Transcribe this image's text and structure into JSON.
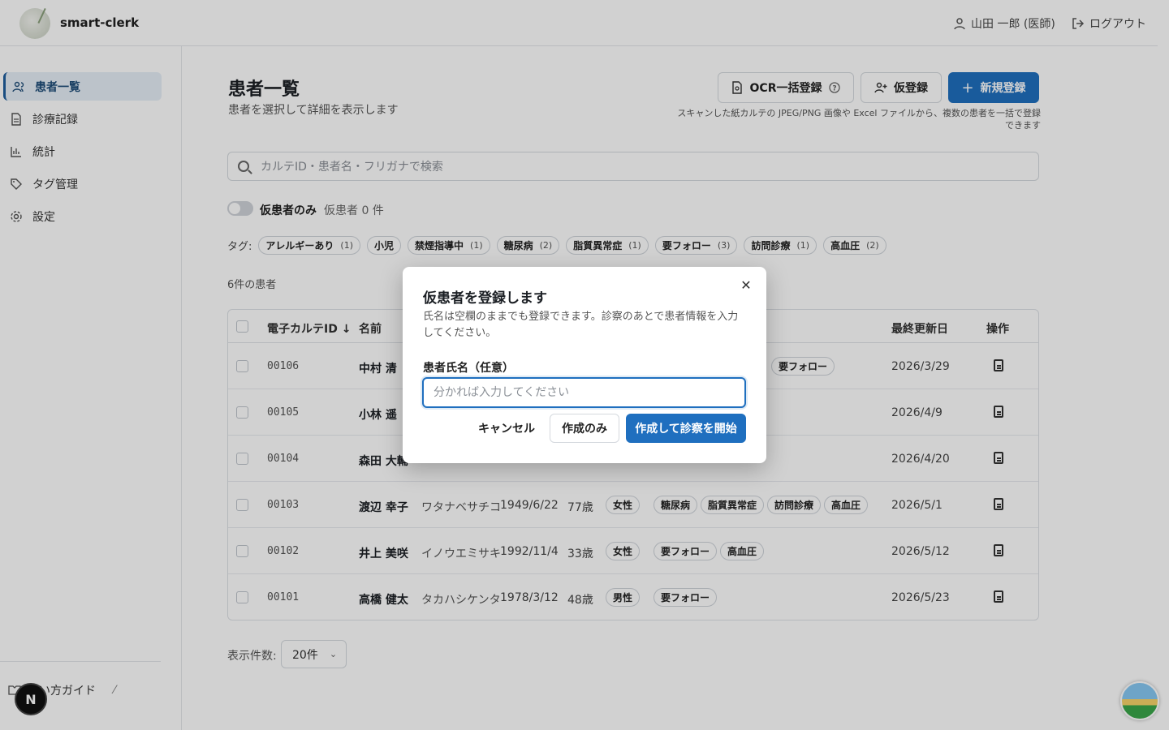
{
  "header": {
    "app_name": "smart-clerk",
    "user": "山田 一郎 (医師)",
    "logout": "ログアウト"
  },
  "sidebar": {
    "items": [
      {
        "label": "患者一覧",
        "icon": "users-icon",
        "active": true
      },
      {
        "label": "診療記録",
        "icon": "file-icon",
        "active": false
      },
      {
        "label": "統計",
        "icon": "chart-icon",
        "active": false
      },
      {
        "label": "タグ管理",
        "icon": "tag-icon",
        "active": false
      },
      {
        "label": "設定",
        "icon": "gear-icon",
        "active": false
      }
    ],
    "guide": "使い方ガイド"
  },
  "main": {
    "title": "患者一覧",
    "subtitle": "患者を選択して詳細を表示します",
    "buttons": {
      "ocr": "OCR一括登録",
      "provisional": "仮登録",
      "new": "新規登録"
    },
    "ocr_note": "スキャンした紙カルテの JPEG/PNG 画像や Excel ファイルから、複数の患者を一括で登録できます",
    "search_placeholder": "カルテID・患者名・フリガナで検索",
    "toggle_label": "仮患者のみ",
    "toggle_count": "仮患者 0 件",
    "tags_label": "タグ:",
    "tags": [
      {
        "name": "アレルギーあり",
        "count": "(1)"
      },
      {
        "name": "小児",
        "count": ""
      },
      {
        "name": "禁煙指導中",
        "count": "(1)"
      },
      {
        "name": "糖尿病",
        "count": "(2)"
      },
      {
        "name": "脂質異常症",
        "count": "(1)"
      },
      {
        "name": "要フォロー",
        "count": "(3)"
      },
      {
        "name": "訪問診療",
        "count": "(1)"
      },
      {
        "name": "高血圧",
        "count": "(2)"
      }
    ],
    "count_label": "6件の患者",
    "table": {
      "headers": {
        "id": "電子カルテID",
        "name": "名前",
        "updated": "最終更新日",
        "actions": "操作"
      },
      "rows": [
        {
          "id": "00106",
          "name": "中村 清",
          "kana": "",
          "dob": "",
          "age": "",
          "gender": "",
          "tags": [
            "要フォロー"
          ],
          "updated": "2026/3/29"
        },
        {
          "id": "00105",
          "name": "小林 遥",
          "kana": "",
          "dob": "",
          "age": "",
          "gender": "",
          "tags": [],
          "updated": "2026/4/9"
        },
        {
          "id": "00104",
          "name": "森田 大輔",
          "kana": "",
          "dob": "",
          "age": "",
          "gender": "",
          "tags": [],
          "updated": "2026/4/20"
        },
        {
          "id": "00103",
          "name": "渡辺 幸子",
          "kana": "ワタナベサチコ",
          "dob": "1949/6/22",
          "age": "77歳",
          "gender": "女性",
          "tags": [
            "糖尿病",
            "脂質異常症",
            "訪問診療",
            "高血圧"
          ],
          "updated": "2026/5/1"
        },
        {
          "id": "00102",
          "name": "井上 美咲",
          "kana": "イノウエミサキ",
          "dob": "1992/11/4",
          "age": "33歳",
          "gender": "女性",
          "tags": [
            "要フォロー",
            "高血圧"
          ],
          "updated": "2026/5/12"
        },
        {
          "id": "00101",
          "name": "高橋 健太",
          "kana": "タカハシケンタ",
          "dob": "1978/3/12",
          "age": "48歳",
          "gender": "男性",
          "tags": [
            "要フォロー"
          ],
          "updated": "2026/5/23"
        }
      ]
    },
    "page_size_label": "表示件数:",
    "page_size_value": "20件"
  },
  "dialog": {
    "title": "仮患者を登録します",
    "description": "氏名は空欄のままでも登録できます。診察のあとで患者情報を入力してください。",
    "field_label": "患者氏名（任意）",
    "placeholder": "分かれば入力してください",
    "cancel": "キャンセル",
    "create_only": "作成のみ",
    "create_and_start": "作成して診察を開始"
  },
  "colors": {
    "primary": "#1f6fbf",
    "active_nav_bg": "#e6eef7"
  }
}
